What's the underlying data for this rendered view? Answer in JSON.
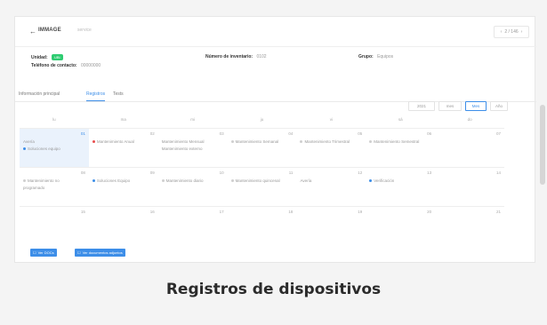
{
  "header": {
    "back_icon": "←",
    "brand": "IMMAGE",
    "brand_sub": "service",
    "pager": {
      "prev": "‹",
      "text": "2 / 146",
      "next": "›"
    }
  },
  "info": {
    "unidad_label": "Unidad:",
    "unidad_badge": "UBI",
    "telefono_label": "Teléfono de contacto:",
    "telefono_value": "00000000",
    "inventario_label": "Número de inventario:",
    "inventario_value": "0102",
    "grupo_label": "Grupo:",
    "grupo_value": "Equipos"
  },
  "tabs": [
    "Información principal",
    "Registros",
    "Tests"
  ],
  "calendar": {
    "year": "2021",
    "select": "mes",
    "view_mes": "Mes",
    "view_ano": "Año",
    "weekdays": [
      "lu",
      "ma",
      "mi",
      "ju",
      "vi",
      "sá",
      "do"
    ],
    "weeks": [
      {
        "days": [
          {
            "num": "01",
            "today": true,
            "events": [
              {
                "text": "Avería",
                "dot": ""
              },
              {
                "text": "Soluciones equipo",
                "dot": "#3d8ee8"
              }
            ]
          },
          {
            "num": "02",
            "events": [
              {
                "text": "Mantenimiento Anual",
                "dot": "#e84d4d"
              }
            ]
          },
          {
            "num": "03",
            "events": [
              {
                "text": "Mantenimiento Mensual",
                "dot": ""
              },
              {
                "text": "Mantenimiento externo",
                "dot": ""
              }
            ]
          },
          {
            "num": "04",
            "events": [
              {
                "text": "Mantenimiento Semanal",
                "dot": "#cfcfcf"
              }
            ]
          },
          {
            "num": "05",
            "events": [
              {
                "text": "Mantenimiento Trimestral",
                "dot": "#cfcfcf"
              }
            ]
          },
          {
            "num": "06",
            "events": [
              {
                "text": "Mantenimiento Semestral",
                "dot": "#cfcfcf"
              }
            ]
          },
          {
            "num": "07",
            "events": []
          }
        ]
      },
      {
        "days": [
          {
            "num": "08",
            "events": [
              {
                "text": "Mantenimiento no",
                "dot": "#cfcfcf"
              },
              {
                "text": "programado",
                "dot": ""
              }
            ]
          },
          {
            "num": "09",
            "events": [
              {
                "text": "Soluciones Equipo",
                "dot": "#3d8ee8"
              }
            ]
          },
          {
            "num": "10",
            "events": [
              {
                "text": "Mantenimiento diario",
                "dot": "#cfcfcf"
              }
            ]
          },
          {
            "num": "11",
            "events": [
              {
                "text": "Mantenimiento quincenal",
                "dot": "#cfcfcf"
              }
            ]
          },
          {
            "num": "12",
            "events": [
              {
                "text": "Avería",
                "dot": ""
              }
            ]
          },
          {
            "num": "13",
            "events": [
              {
                "text": "Verificación",
                "dot": "#3d8ee8"
              }
            ]
          },
          {
            "num": "14",
            "events": []
          }
        ]
      },
      {
        "days": [
          {
            "num": "15",
            "events": []
          },
          {
            "num": "16",
            "events": []
          },
          {
            "num": "17",
            "events": []
          },
          {
            "num": "18",
            "events": []
          },
          {
            "num": "19",
            "events": []
          },
          {
            "num": "20",
            "events": []
          },
          {
            "num": "21",
            "events": []
          }
        ]
      }
    ]
  },
  "buttons": {
    "btn1_icon": "☐",
    "btn1": "Ver DOCs",
    "btn2_icon": "☐",
    "btn2": "Ver documentos adjuntos"
  },
  "caption": "Registros de dispositivos",
  "colors": {
    "accent": "#3d8ee8",
    "badge": "#2ecc71",
    "alert": "#e84d4d"
  }
}
